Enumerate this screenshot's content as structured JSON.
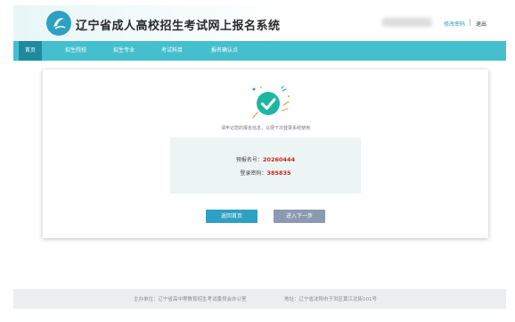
{
  "header": {
    "title": "辽宁省成人高校招生考试网上报名系统",
    "change_password": "修改密码",
    "logout": "退出"
  },
  "nav": {
    "items": [
      {
        "label": "首页",
        "active": true
      },
      {
        "label": "招生院校",
        "active": false
      },
      {
        "label": "招生专业",
        "active": false
      },
      {
        "label": "考试科目",
        "active": false
      },
      {
        "label": "报名确认点",
        "active": false
      }
    ]
  },
  "result": {
    "note": "请牢记您的报名信息，以便下次登录系统使用",
    "reg_label": "预报名号：",
    "reg_value": "20260444",
    "pwd_label": "登录密码：",
    "pwd_value": "385835"
  },
  "buttons": {
    "home": "返回首页",
    "next": "进入下一步"
  },
  "footer": {
    "host": "主办单位：辽宁省高中等教育招生考试委员会办公室",
    "address": "地址：辽宁省沈阳市于洪区黄江北街101号"
  },
  "colors": {
    "nav": "#45bfce",
    "nav_active": "#1e8aa0",
    "accent": "#2ea0c2",
    "success": "#1fb5a3",
    "highlight": "#d62020"
  }
}
